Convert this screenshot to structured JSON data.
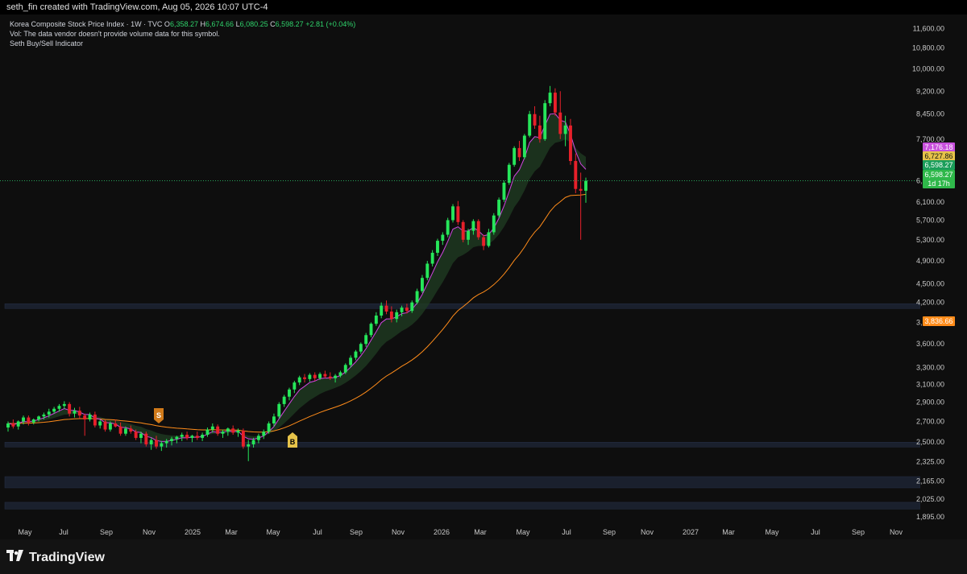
{
  "header": {
    "text": "seth_fin created with TradingView.com, Aug 05, 2026 10:07 UTC-4"
  },
  "legend": {
    "symbol": "Korea Composite Stock Price Index · 1W · TVC",
    "open_label": "O",
    "open": "6,358.27",
    "high_label": "H",
    "high": "6,674.66",
    "low_label": "L",
    "low": "6,080.25",
    "close_label": "C",
    "close": "6,598.27",
    "change": "+2.81 (+0.04%)",
    "vol_line": "Vol: The data vendor doesn't provide volume data for this symbol.",
    "indicator": "Seth Buy/Sell Indicator"
  },
  "brand": {
    "name": "TradingView"
  },
  "colors": {
    "up": "#26e65a",
    "down": "#e8202a",
    "ma_fast": "#d046e0",
    "ma_slow": "#ff8c1a",
    "cloud": "#1f3b22",
    "zone": "#1d2433"
  },
  "chart_data": {
    "type": "candlestick",
    "title": "Korea Composite Stock Price Index · 1W · TVC",
    "y_scale": "log",
    "ylim": [
      1850,
      11800
    ],
    "y_ticks": [
      "11,600.00",
      "10,800.00",
      "10,000.00",
      "9,200.00",
      "8,450.00",
      "7,700.00",
      "6,598.27",
      "6,100.00",
      "5,700.00",
      "5,300.00",
      "4,900.00",
      "4,500.00",
      "4,200.00",
      "3,900.00",
      "3,600.00",
      "3,300.00",
      "3,100.00",
      "2,900.00",
      "2,700.00",
      "2,500.00",
      "2,325.00",
      "2,165.00",
      "2,025.00",
      "1,895.00"
    ],
    "x_ticks": [
      "May",
      "Jul",
      "Sep",
      "Nov",
      "2025",
      "Mar",
      "May",
      "Jul",
      "Sep",
      "Nov",
      "2026",
      "Mar",
      "May",
      "Jul",
      "Sep",
      "Nov",
      "2027",
      "Mar",
      "May",
      "Jul",
      "Sep",
      "Nov"
    ],
    "price_labels": [
      {
        "value": "7,176.18",
        "color": "#c850dc"
      },
      {
        "value": "6,727.86",
        "color": "#e6c34a"
      },
      {
        "value": "6,598.27",
        "color": "#1b9e5a"
      },
      {
        "value": "6,598.27",
        "color": "#2fb84a"
      },
      {
        "value": "1d 17h",
        "color": "#2fb84a"
      },
      {
        "value": "3,836.66",
        "color": "#ff8c1a"
      }
    ],
    "signals": [
      {
        "label": "S",
        "type": "sell",
        "near": "Dec 2024"
      },
      {
        "label": "B",
        "type": "buy",
        "near": "Jun 2025"
      }
    ],
    "zones": [
      [
        4120,
        4180
      ],
      [
        2470,
        2500
      ],
      [
        2110,
        2200
      ],
      [
        1950,
        2000
      ]
    ],
    "candles": [
      {
        "o": 2640,
        "h": 2700,
        "l": 2600,
        "c": 2680
      },
      {
        "o": 2680,
        "h": 2720,
        "l": 2630,
        "c": 2650
      },
      {
        "o": 2650,
        "h": 2710,
        "l": 2620,
        "c": 2700
      },
      {
        "o": 2700,
        "h": 2760,
        "l": 2670,
        "c": 2740
      },
      {
        "o": 2740,
        "h": 2760,
        "l": 2660,
        "c": 2690
      },
      {
        "o": 2690,
        "h": 2730,
        "l": 2670,
        "c": 2720
      },
      {
        "o": 2720,
        "h": 2760,
        "l": 2700,
        "c": 2750
      },
      {
        "o": 2750,
        "h": 2790,
        "l": 2720,
        "c": 2770
      },
      {
        "o": 2770,
        "h": 2830,
        "l": 2740,
        "c": 2800
      },
      {
        "o": 2800,
        "h": 2850,
        "l": 2780,
        "c": 2830
      },
      {
        "o": 2830,
        "h": 2880,
        "l": 2800,
        "c": 2860
      },
      {
        "o": 2860,
        "h": 2910,
        "l": 2830,
        "c": 2880
      },
      {
        "o": 2880,
        "h": 2900,
        "l": 2750,
        "c": 2780
      },
      {
        "o": 2780,
        "h": 2840,
        "l": 2740,
        "c": 2810
      },
      {
        "o": 2810,
        "h": 2850,
        "l": 2730,
        "c": 2760
      },
      {
        "o": 2760,
        "h": 2780,
        "l": 2560,
        "c": 2720
      },
      {
        "o": 2720,
        "h": 2790,
        "l": 2700,
        "c": 2770
      },
      {
        "o": 2770,
        "h": 2800,
        "l": 2640,
        "c": 2660
      },
      {
        "o": 2660,
        "h": 2720,
        "l": 2630,
        "c": 2700
      },
      {
        "o": 2700,
        "h": 2720,
        "l": 2600,
        "c": 2620
      },
      {
        "o": 2620,
        "h": 2700,
        "l": 2600,
        "c": 2680
      },
      {
        "o": 2680,
        "h": 2720,
        "l": 2640,
        "c": 2650
      },
      {
        "o": 2650,
        "h": 2690,
        "l": 2560,
        "c": 2580
      },
      {
        "o": 2580,
        "h": 2650,
        "l": 2560,
        "c": 2630
      },
      {
        "o": 2630,
        "h": 2660,
        "l": 2580,
        "c": 2600
      },
      {
        "o": 2600,
        "h": 2620,
        "l": 2520,
        "c": 2540
      },
      {
        "o": 2540,
        "h": 2600,
        "l": 2490,
        "c": 2580
      },
      {
        "o": 2580,
        "h": 2600,
        "l": 2460,
        "c": 2480
      },
      {
        "o": 2480,
        "h": 2540,
        "l": 2430,
        "c": 2520
      },
      {
        "o": 2520,
        "h": 2560,
        "l": 2440,
        "c": 2460
      },
      {
        "o": 2460,
        "h": 2510,
        "l": 2420,
        "c": 2490
      },
      {
        "o": 2490,
        "h": 2530,
        "l": 2450,
        "c": 2510
      },
      {
        "o": 2510,
        "h": 2550,
        "l": 2470,
        "c": 2530
      },
      {
        "o": 2530,
        "h": 2560,
        "l": 2490,
        "c": 2550
      },
      {
        "o": 2550,
        "h": 2590,
        "l": 2510,
        "c": 2570
      },
      {
        "o": 2570,
        "h": 2600,
        "l": 2520,
        "c": 2540
      },
      {
        "o": 2540,
        "h": 2570,
        "l": 2500,
        "c": 2560
      },
      {
        "o": 2560,
        "h": 2600,
        "l": 2520,
        "c": 2540
      },
      {
        "o": 2540,
        "h": 2590,
        "l": 2510,
        "c": 2570
      },
      {
        "o": 2570,
        "h": 2640,
        "l": 2550,
        "c": 2620
      },
      {
        "o": 2620,
        "h": 2680,
        "l": 2590,
        "c": 2650
      },
      {
        "o": 2650,
        "h": 2670,
        "l": 2560,
        "c": 2580
      },
      {
        "o": 2580,
        "h": 2620,
        "l": 2540,
        "c": 2600
      },
      {
        "o": 2600,
        "h": 2640,
        "l": 2560,
        "c": 2630
      },
      {
        "o": 2630,
        "h": 2660,
        "l": 2570,
        "c": 2590
      },
      {
        "o": 2590,
        "h": 2630,
        "l": 2550,
        "c": 2610
      },
      {
        "o": 2610,
        "h": 2630,
        "l": 2440,
        "c": 2460
      },
      {
        "o": 2460,
        "h": 2520,
        "l": 2330,
        "c": 2480
      },
      {
        "o": 2480,
        "h": 2540,
        "l": 2450,
        "c": 2520
      },
      {
        "o": 2520,
        "h": 2580,
        "l": 2490,
        "c": 2560
      },
      {
        "o": 2560,
        "h": 2620,
        "l": 2530,
        "c": 2600
      },
      {
        "o": 2600,
        "h": 2700,
        "l": 2580,
        "c": 2680
      },
      {
        "o": 2680,
        "h": 2780,
        "l": 2650,
        "c": 2750
      },
      {
        "o": 2750,
        "h": 2900,
        "l": 2730,
        "c": 2880
      },
      {
        "o": 2880,
        "h": 2980,
        "l": 2850,
        "c": 2960
      },
      {
        "o": 2960,
        "h": 3060,
        "l": 2920,
        "c": 3040
      },
      {
        "o": 3040,
        "h": 3140,
        "l": 3000,
        "c": 3120
      },
      {
        "o": 3120,
        "h": 3200,
        "l": 3090,
        "c": 3180
      },
      {
        "o": 3180,
        "h": 3220,
        "l": 3120,
        "c": 3160
      },
      {
        "o": 3160,
        "h": 3230,
        "l": 3130,
        "c": 3210
      },
      {
        "o": 3210,
        "h": 3240,
        "l": 3140,
        "c": 3170
      },
      {
        "o": 3170,
        "h": 3240,
        "l": 3150,
        "c": 3220
      },
      {
        "o": 3220,
        "h": 3260,
        "l": 3170,
        "c": 3190
      },
      {
        "o": 3190,
        "h": 3240,
        "l": 3150,
        "c": 3170
      },
      {
        "o": 3170,
        "h": 3220,
        "l": 3120,
        "c": 3200
      },
      {
        "o": 3200,
        "h": 3260,
        "l": 3180,
        "c": 3240
      },
      {
        "o": 3240,
        "h": 3350,
        "l": 3220,
        "c": 3330
      },
      {
        "o": 3330,
        "h": 3450,
        "l": 3300,
        "c": 3420
      },
      {
        "o": 3420,
        "h": 3520,
        "l": 3390,
        "c": 3500
      },
      {
        "o": 3500,
        "h": 3620,
        "l": 3470,
        "c": 3600
      },
      {
        "o": 3600,
        "h": 3750,
        "l": 3560,
        "c": 3720
      },
      {
        "o": 3720,
        "h": 3900,
        "l": 3690,
        "c": 3880
      },
      {
        "o": 3880,
        "h": 4050,
        "l": 3850,
        "c": 4000
      },
      {
        "o": 4000,
        "h": 4200,
        "l": 3960,
        "c": 4150
      },
      {
        "o": 4150,
        "h": 4230,
        "l": 4020,
        "c": 4060
      },
      {
        "o": 4060,
        "h": 4140,
        "l": 3900,
        "c": 3950
      },
      {
        "o": 3950,
        "h": 4090,
        "l": 3900,
        "c": 4050
      },
      {
        "o": 4050,
        "h": 4150,
        "l": 3990,
        "c": 4120
      },
      {
        "o": 4120,
        "h": 4180,
        "l": 4030,
        "c": 4070
      },
      {
        "o": 4070,
        "h": 4230,
        "l": 4040,
        "c": 4200
      },
      {
        "o": 4200,
        "h": 4420,
        "l": 4170,
        "c": 4380
      },
      {
        "o": 4380,
        "h": 4650,
        "l": 4350,
        "c": 4600
      },
      {
        "o": 4600,
        "h": 4900,
        "l": 4560,
        "c": 4850
      },
      {
        "o": 4850,
        "h": 5100,
        "l": 4800,
        "c": 5050
      },
      {
        "o": 5050,
        "h": 5320,
        "l": 4990,
        "c": 5280
      },
      {
        "o": 5280,
        "h": 5450,
        "l": 5200,
        "c": 5400
      },
      {
        "o": 5400,
        "h": 5750,
        "l": 5350,
        "c": 5700
      },
      {
        "o": 5700,
        "h": 6050,
        "l": 5650,
        "c": 6000
      },
      {
        "o": 6000,
        "h": 6120,
        "l": 5600,
        "c": 5660
      },
      {
        "o": 5660,
        "h": 5700,
        "l": 5250,
        "c": 5300
      },
      {
        "o": 5300,
        "h": 5520,
        "l": 5200,
        "c": 5480
      },
      {
        "o": 5480,
        "h": 5720,
        "l": 5400,
        "c": 5680
      },
      {
        "o": 5680,
        "h": 5720,
        "l": 5300,
        "c": 5350
      },
      {
        "o": 5350,
        "h": 5400,
        "l": 5100,
        "c": 5180
      },
      {
        "o": 5180,
        "h": 5520,
        "l": 5150,
        "c": 5450
      },
      {
        "o": 5450,
        "h": 5850,
        "l": 5400,
        "c": 5800
      },
      {
        "o": 5800,
        "h": 6200,
        "l": 5750,
        "c": 6150
      },
      {
        "o": 6150,
        "h": 6600,
        "l": 6100,
        "c": 6550
      },
      {
        "o": 6550,
        "h": 7050,
        "l": 6500,
        "c": 7000
      },
      {
        "o": 7000,
        "h": 7500,
        "l": 6950,
        "c": 7450
      },
      {
        "o": 7450,
        "h": 7650,
        "l": 7100,
        "c": 7200
      },
      {
        "o": 7200,
        "h": 7850,
        "l": 7150,
        "c": 7800
      },
      {
        "o": 7800,
        "h": 8550,
        "l": 7750,
        "c": 8450
      },
      {
        "o": 8450,
        "h": 8700,
        "l": 8000,
        "c": 8100
      },
      {
        "o": 8100,
        "h": 8400,
        "l": 7600,
        "c": 7700
      },
      {
        "o": 7700,
        "h": 8900,
        "l": 7650,
        "c": 8800
      },
      {
        "o": 8800,
        "h": 9380,
        "l": 8700,
        "c": 9150
      },
      {
        "o": 9150,
        "h": 9300,
        "l": 8400,
        "c": 8500
      },
      {
        "o": 8500,
        "h": 9200,
        "l": 7700,
        "c": 7850
      },
      {
        "o": 7850,
        "h": 8400,
        "l": 7500,
        "c": 8100
      },
      {
        "o": 8100,
        "h": 8300,
        "l": 7000,
        "c": 7100
      },
      {
        "o": 7100,
        "h": 7300,
        "l": 6300,
        "c": 6400
      },
      {
        "o": 6400,
        "h": 6800,
        "l": 5300,
        "c": 6358
      },
      {
        "o": 6358,
        "h": 6674,
        "l": 6080,
        "c": 6598
      }
    ]
  }
}
